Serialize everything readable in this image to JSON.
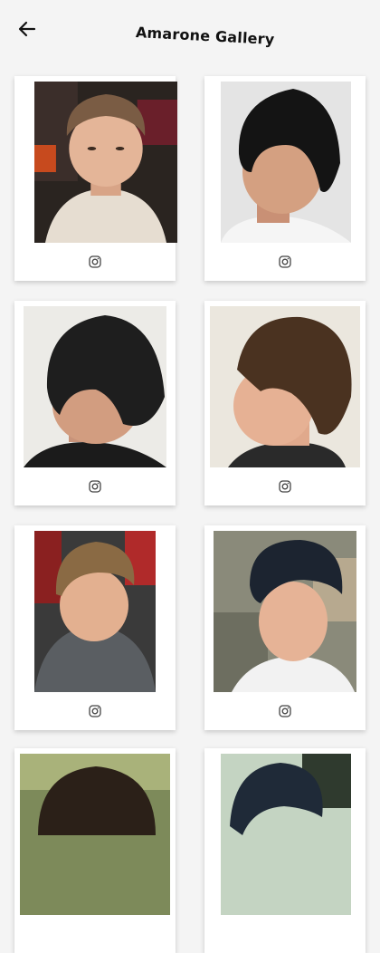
{
  "app": {
    "title": "Amarone Gallery"
  },
  "header": {
    "back_icon": "arrow-left-icon"
  },
  "gallery": {
    "items": [
      {
        "name": "photo-1",
        "link_icon": "instagram-icon"
      },
      {
        "name": "photo-2",
        "link_icon": "instagram-icon"
      },
      {
        "name": "photo-3",
        "link_icon": "instagram-icon"
      },
      {
        "name": "photo-4",
        "link_icon": "instagram-icon"
      },
      {
        "name": "photo-5",
        "link_icon": "instagram-icon"
      },
      {
        "name": "photo-6",
        "link_icon": "instagram-icon"
      },
      {
        "name": "photo-7",
        "link_icon": "instagram-icon"
      },
      {
        "name": "photo-8",
        "link_icon": "instagram-icon"
      }
    ]
  },
  "colors": {
    "background": "#f4f4f4",
    "card": "#ffffff",
    "text": "#111111"
  }
}
